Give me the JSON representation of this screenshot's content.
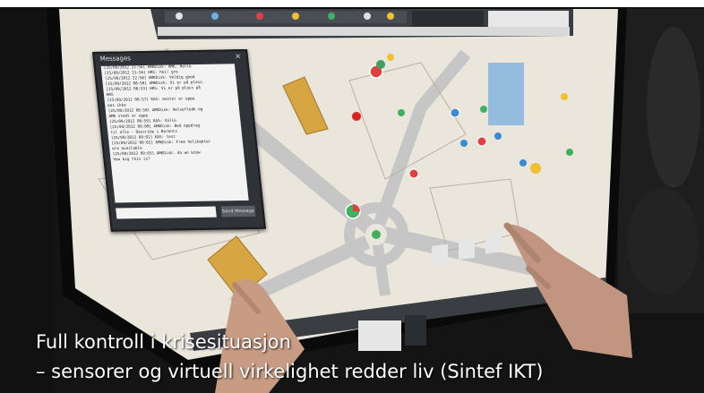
{
  "caption": {
    "line1": "Full kontroll i krisesituasjon",
    "line2": "– sensorer og virtuell virkelighet redder liv (Sintef IKT)"
  },
  "messages_panel": {
    "title": "Messages",
    "close_glyph": "×",
    "send_label": "Send Message",
    "lines": [
      "[25/09/2012 21:56] AMKDisk: AMK, Hallo",
      "[25/09/2012 21:56] HRS: hei! gro",
      "[25/09/2012 22:58] AMKDisk: Veldig good",
      "[25/09/2012 08:58] AMKDisk: Vi er på plass.",
      "[25/09/2012 08:53] HRS: Vi er på plass på",
      "HRS",
      "[25/09/2012 08:57] KAS: master er oppe",
      "pas ikke",
      "[25/09/2012 08:58] AMKDisk: Helseflodk og",
      "AMK stedt er oppe",
      "[25/09/2012 08:59] KAS: hallo",
      "[25/09/2012 09:00] AMKDisk: Bed oppdrag",
      "til alle - Describe i Barents",
      "[25/09/2012 09:02] KAS: test",
      "[25/09/2012 09:02] AMKDisk: Free helikopter",
      "ere available",
      "[25/09/2012 09:03] AMKDisk: do we know",
      "how big this is?"
    ]
  },
  "colors": {
    "map_background": "#e9e4da",
    "road": "#c8c8c8",
    "building_highlight": "#d8a543",
    "toolbar": "#3a3d42",
    "caption_text": "#ffffff"
  }
}
